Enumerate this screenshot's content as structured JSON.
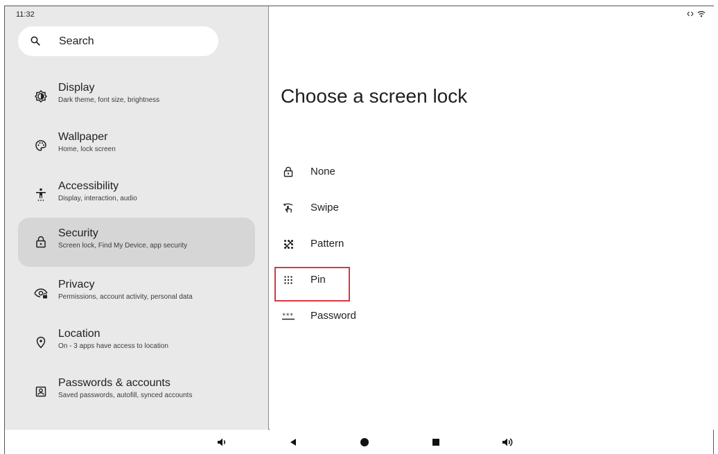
{
  "status_bar": {
    "time": "11:32"
  },
  "search": {
    "label": "Search"
  },
  "sidebar": {
    "items": [
      {
        "title": "Display",
        "subtitle": "Dark theme, font size, brightness",
        "icon": "display-brightness-icon"
      },
      {
        "title": "Wallpaper",
        "subtitle": "Home, lock screen",
        "icon": "palette-icon"
      },
      {
        "title": "Accessibility",
        "subtitle": "Display, interaction, audio",
        "icon": "accessibility-icon"
      },
      {
        "title": "Security",
        "subtitle": "Screen lock, Find My Device, app security",
        "icon": "lock-icon",
        "selected": true
      },
      {
        "title": "Privacy",
        "subtitle": "Permissions, account activity, personal data",
        "icon": "privacy-eye-icon"
      },
      {
        "title": "Location",
        "subtitle": "On - 3 apps have access to location",
        "icon": "location-pin-icon"
      },
      {
        "title": "Passwords & accounts",
        "subtitle": "Saved passwords, autofill, synced accounts",
        "icon": "account-box-icon"
      }
    ]
  },
  "main": {
    "title": "Choose a screen lock",
    "options": [
      {
        "label": "None",
        "icon": "lock-icon"
      },
      {
        "label": "Swipe",
        "icon": "swipe-icon"
      },
      {
        "label": "Pattern",
        "icon": "pattern-icon"
      },
      {
        "label": "Pin",
        "icon": "pin-dots-icon",
        "highlighted": true
      },
      {
        "label": "Password",
        "icon": "password-icon"
      }
    ]
  },
  "navbar": {
    "buttons": [
      "volume-down-icon",
      "back-icon",
      "home-icon",
      "recents-icon",
      "volume-up-icon"
    ]
  },
  "colors": {
    "sidebar_bg": "#e9e9e9",
    "selected_bg": "#d6d6d6",
    "highlight_border": "#d9363e"
  }
}
